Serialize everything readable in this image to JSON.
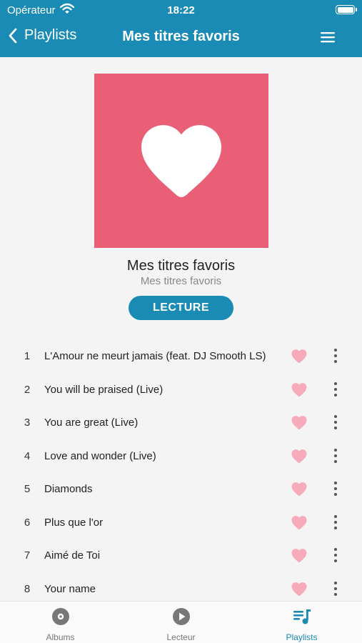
{
  "status_bar": {
    "carrier": "Opérateur",
    "time": "18:22"
  },
  "nav": {
    "back_label": "Playlists",
    "title": "Mes titres favoris"
  },
  "playlist": {
    "title": "Mes titres favoris",
    "subtitle": "Mes titres favoris",
    "play_label": "LECTURE"
  },
  "tracks": [
    {
      "number": "1",
      "title": "L'Amour ne meurt jamais (feat. DJ Smooth LS)"
    },
    {
      "number": "2",
      "title": "You will be praised (Live)"
    },
    {
      "number": "3",
      "title": "You are great (Live)"
    },
    {
      "number": "4",
      "title": "Love and wonder (Live)"
    },
    {
      "number": "5",
      "title": "Diamonds"
    },
    {
      "number": "6",
      "title": "Plus que l'or"
    },
    {
      "number": "7",
      "title": "Aimé de Toi"
    },
    {
      "number": "8",
      "title": "Your name"
    }
  ],
  "tabs": [
    {
      "label": "Albums",
      "icon": "disc-icon"
    },
    {
      "label": "Lecteur",
      "icon": "play-circle-icon"
    },
    {
      "label": "Playlists",
      "icon": "playlist-icon",
      "active": true
    }
  ],
  "colors": {
    "accent": "#1a8bb4",
    "cover": "#e85f76",
    "favorite": "#f7aab9"
  }
}
